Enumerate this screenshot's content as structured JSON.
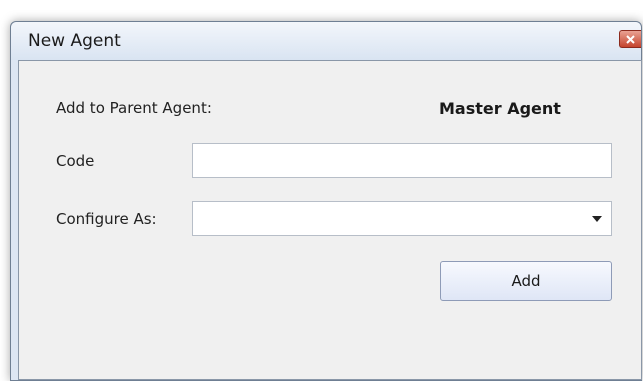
{
  "window": {
    "title": "New Agent"
  },
  "form": {
    "parent_label": "Add to Parent Agent:",
    "parent_value": "Master Agent",
    "code_label": "Code",
    "code_value": "",
    "configure_label": "Configure As:",
    "configure_value": "",
    "add_label": "Add"
  },
  "icons": {
    "close": "close-icon",
    "dropdown": "chevron-down-icon"
  },
  "colors": {
    "close_button": "#c5442d",
    "titlebar": "#dde6f3",
    "client_background": "#f0f0f0"
  }
}
